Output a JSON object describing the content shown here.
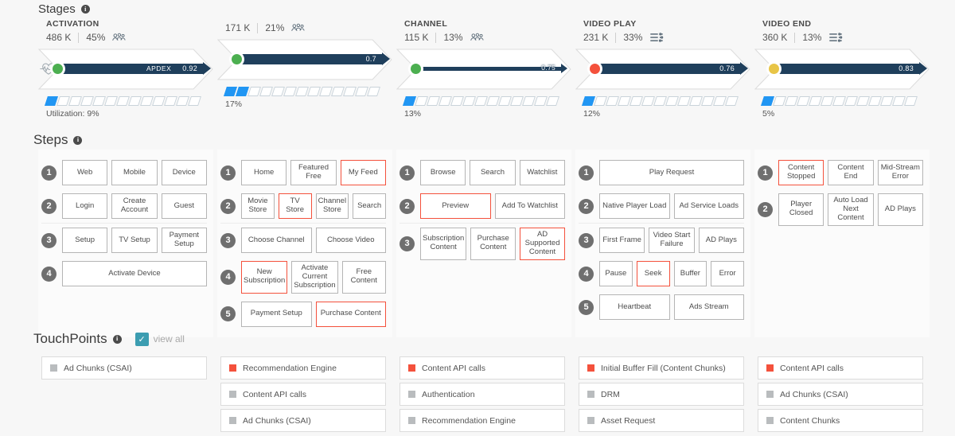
{
  "sections": {
    "stages": {
      "title": "Stages",
      "info_icon": "info-icon"
    },
    "steps": {
      "title": "Steps",
      "info_icon": "info-icon"
    },
    "touchpoints": {
      "title": "TouchPoints",
      "info_icon": "info-icon",
      "view_all_label": "view all",
      "checkbox_checked": true,
      "check_glyph": "✓"
    }
  },
  "colors": {
    "accent_blue": "#2196f3",
    "bar_navy": "#1f3f5c",
    "alert_red": "#f4513c",
    "status_green": "#4caf50",
    "status_yellow": "#e8c547",
    "status_red": "#f4513c",
    "teal_checkbox": "#3c9db1",
    "grey_swatch": "#b9bcbe",
    "step_num_grey": "#6f6f6f"
  },
  "stages": [
    {
      "name": "ACTIVATION",
      "count": "486 K",
      "percent": "45%",
      "metric_icon": "users-icon",
      "apdex_word": "APDEX",
      "apdex_value": "0.92",
      "dot_color": "#4caf50",
      "dot_status": "green",
      "show_pulse_icon": true,
      "bar_style": "thick",
      "utilization_label": "Utilization: 9%",
      "utilization_filled": 1,
      "utilization_total": 13
    },
    {
      "name": "",
      "count": "171 K",
      "percent": "21%",
      "metric_icon": "users-icon",
      "apdex_word": "",
      "apdex_value": "0.7",
      "dot_color": "#4caf50",
      "dot_status": "green",
      "show_pulse_icon": false,
      "bar_style": "thick",
      "utilization_label": "17%",
      "utilization_filled": 2,
      "utilization_total": 13
    },
    {
      "name": "CHANNEL",
      "count": "115 K",
      "percent": "13%",
      "metric_icon": "users-icon",
      "apdex_word": "",
      "apdex_value": "0.75",
      "dot_color": "#4caf50",
      "dot_status": "green",
      "show_pulse_icon": false,
      "bar_style": "thin",
      "utilization_label": "13%",
      "utilization_filled": 1,
      "utilization_total": 13
    },
    {
      "name": "VIDEO PLAY",
      "count": "231 K",
      "percent": "33%",
      "metric_icon": "video-settings-icon",
      "apdex_word": "",
      "apdex_value": "0.76",
      "dot_color": "#f4513c",
      "dot_status": "red",
      "show_pulse_icon": false,
      "bar_style": "thick",
      "utilization_label": "12%",
      "utilization_filled": 1,
      "utilization_total": 13
    },
    {
      "name": "VIDEO END",
      "count": "360 K",
      "percent": "13%",
      "metric_icon": "video-settings-icon",
      "apdex_word": "",
      "apdex_value": "0.83",
      "dot_color": "#e8c547",
      "dot_status": "yellow",
      "show_pulse_icon": false,
      "bar_style": "thick",
      "utilization_label": "5%",
      "utilization_filled": 1,
      "utilization_total": 13
    }
  ],
  "steps": [
    {
      "column": "activation",
      "rows": [
        {
          "num": "1",
          "separator": false,
          "buttons": [
            {
              "label": "Web",
              "alert": false
            },
            {
              "label": "Mobile",
              "alert": false
            },
            {
              "label": "Device",
              "alert": false
            }
          ]
        },
        {
          "num": "2",
          "separator": false,
          "buttons": [
            {
              "label": "Login",
              "alert": false
            },
            {
              "label": "Create Account",
              "alert": false
            },
            {
              "label": "Guest",
              "alert": false
            }
          ]
        },
        {
          "num": "3",
          "separator": true,
          "buttons": [
            {
              "label": "Setup",
              "alert": false
            },
            {
              "label": "TV Setup",
              "alert": false
            },
            {
              "label": "Payment Setup",
              "alert": false
            }
          ]
        },
        {
          "num": "4",
          "separator": false,
          "buttons": [
            {
              "label": "Activate Device",
              "alert": false
            }
          ]
        }
      ]
    },
    {
      "column": "discovery",
      "rows": [
        {
          "num": "1",
          "separator": false,
          "buttons": [
            {
              "label": "Home",
              "alert": false
            },
            {
              "label": "Featured Free",
              "alert": false
            },
            {
              "label": "My Feed",
              "alert": true
            }
          ]
        },
        {
          "num": "2",
          "separator": false,
          "buttons": [
            {
              "label": "Movie Store",
              "alert": false
            },
            {
              "label": "TV Store",
              "alert": true
            },
            {
              "label": "Channel Store",
              "alert": false
            },
            {
              "label": "Search",
              "alert": false
            }
          ]
        },
        {
          "num": "3",
          "separator": true,
          "buttons": [
            {
              "label": "Choose Channel",
              "alert": false
            },
            {
              "label": "Choose Video",
              "alert": false
            }
          ]
        },
        {
          "num": "4",
          "separator": false,
          "buttons": [
            {
              "label": "New Subscription",
              "alert": true
            },
            {
              "label": "Activate Current Subscription",
              "alert": false
            },
            {
              "label": "Free Content",
              "alert": false
            }
          ]
        },
        {
          "num": "5",
          "separator": false,
          "buttons": [
            {
              "label": "Payment Setup",
              "alert": false
            },
            {
              "label": "Purchase Content",
              "alert": true
            }
          ]
        }
      ]
    },
    {
      "column": "channel",
      "rows": [
        {
          "num": "1",
          "separator": false,
          "buttons": [
            {
              "label": "Browse",
              "alert": false
            },
            {
              "label": "Search",
              "alert": false
            },
            {
              "label": "Watchlist",
              "alert": false
            }
          ]
        },
        {
          "num": "2",
          "separator": false,
          "buttons": [
            {
              "label": "Preview",
              "alert": true
            },
            {
              "label": "Add To Watchlist",
              "alert": false
            }
          ]
        },
        {
          "num": "3",
          "separator": true,
          "buttons": [
            {
              "label": "Subscription Content",
              "alert": false
            },
            {
              "label": "Purchase Content",
              "alert": false
            },
            {
              "label": "AD Supported Content",
              "alert": true
            }
          ]
        }
      ]
    },
    {
      "column": "video-play",
      "rows": [
        {
          "num": "1",
          "separator": false,
          "buttons": [
            {
              "label": "Play Request",
              "alert": false
            }
          ]
        },
        {
          "num": "2",
          "separator": false,
          "buttons": [
            {
              "label": "Native Player Load",
              "alert": false
            },
            {
              "label": "Ad Service Loads",
              "alert": false
            }
          ]
        },
        {
          "num": "3",
          "separator": true,
          "buttons": [
            {
              "label": "First Frame",
              "alert": false
            },
            {
              "label": "Video Start Failure",
              "alert": false
            },
            {
              "label": "AD Plays",
              "alert": false
            }
          ]
        },
        {
          "num": "4",
          "separator": false,
          "buttons": [
            {
              "label": "Pause",
              "alert": false
            },
            {
              "label": "Seek",
              "alert": true
            },
            {
              "label": "Buffer",
              "alert": false
            },
            {
              "label": "Error",
              "alert": false
            }
          ]
        },
        {
          "num": "5",
          "separator": false,
          "buttons": [
            {
              "label": "Heartbeat",
              "alert": false
            },
            {
              "label": "Ads Stream",
              "alert": false
            }
          ]
        }
      ]
    },
    {
      "column": "video-end",
      "rows": [
        {
          "num": "1",
          "separator": false,
          "buttons": [
            {
              "label": "Content Stopped",
              "alert": true
            },
            {
              "label": "Content End",
              "alert": false
            },
            {
              "label": "Mid-Stream Error",
              "alert": false
            }
          ]
        },
        {
          "num": "2",
          "separator": false,
          "buttons": [
            {
              "label": "Player Closed",
              "alert": false
            },
            {
              "label": "Auto Load Next Content",
              "alert": false
            },
            {
              "label": "AD Plays",
              "alert": false
            }
          ]
        }
      ]
    }
  ],
  "touchpoints": [
    {
      "column": "activation",
      "items": [
        {
          "label": "Ad Chunks (CSAI)",
          "status": "grey"
        }
      ]
    },
    {
      "column": "discovery",
      "items": [
        {
          "label": "Recommendation Engine",
          "status": "red"
        },
        {
          "label": "Content API calls",
          "status": "grey"
        },
        {
          "label": "Ad Chunks (CSAI)",
          "status": "grey"
        }
      ]
    },
    {
      "column": "channel",
      "items": [
        {
          "label": "Content API calls",
          "status": "red"
        },
        {
          "label": "Authentication",
          "status": "grey"
        },
        {
          "label": "Recommendation Engine",
          "status": "grey"
        }
      ]
    },
    {
      "column": "video-play",
      "items": [
        {
          "label": "Initial Buffer Fill (Content Chunks)",
          "status": "red"
        },
        {
          "label": "DRM",
          "status": "grey"
        },
        {
          "label": "Asset Request",
          "status": "grey"
        }
      ]
    },
    {
      "column": "video-end",
      "items": [
        {
          "label": "Content API calls",
          "status": "red"
        },
        {
          "label": "Ad Chunks (CSAI)",
          "status": "grey"
        },
        {
          "label": "Content Chunks",
          "status": "grey"
        }
      ]
    }
  ]
}
